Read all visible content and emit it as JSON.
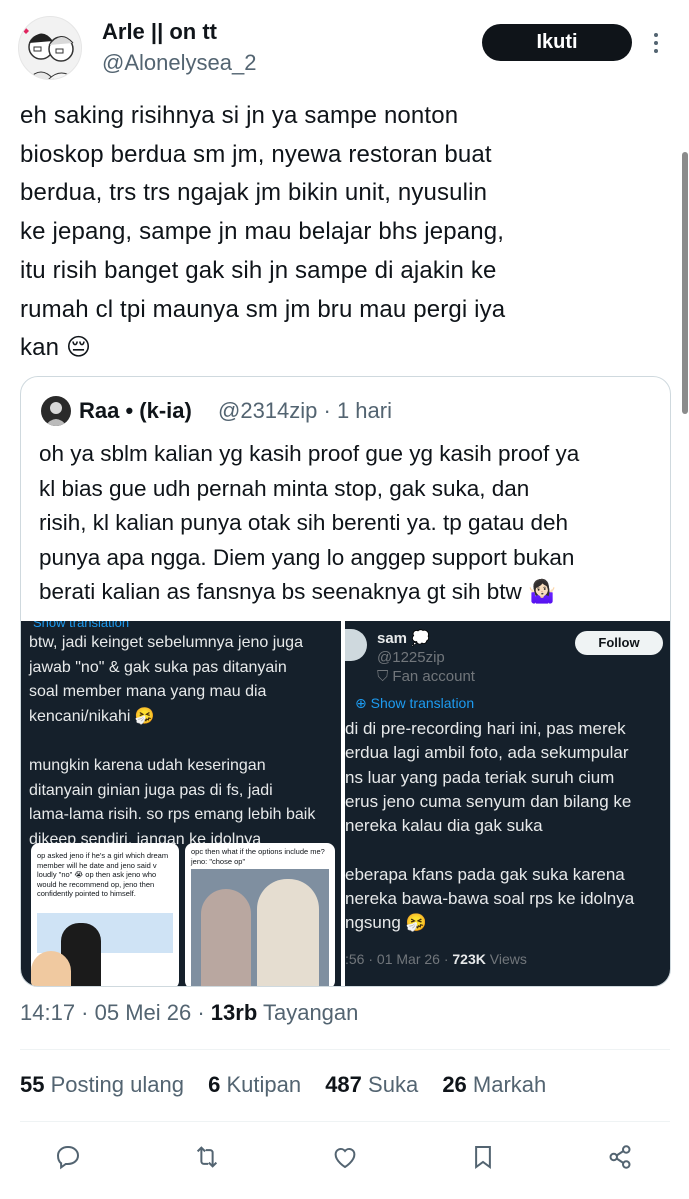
{
  "author": {
    "name": "Arle || on tt",
    "handle": "@Alonelysea_2"
  },
  "follow_label": "Ikuti",
  "tweet_lines": [
    "eh saking risihnya si jn ya sampe nonton",
    "bioskop berdua sm jm, nyewa restoran buat",
    "berdua, trs trs ngajak jm bikin unit, nyusulin",
    "ke jepang, sampe jn mau belajar bhs jepang,",
    "itu risih banget gak sih jn sampe di ajakin ke",
    "rumah cl tpi maunya sm jm bru mau pergi iya",
    "kan 😔"
  ],
  "quote": {
    "name": "Raa • (k-ia)",
    "handle_time": "@2314zip · 1 hari",
    "lines": [
      "oh ya sblm kalian yg kasih proof gue yg kasih proof ya",
      "kl bias gue udh pernah minta stop, gak suka, dan",
      "risih, kl kalian punya otak sih berenti ya. tp gatau deh",
      "punya apa ngga. Diem yang lo anggep support bukan",
      "berati kalian as fansnya bs seenaknya gt sih btw 🤷🏻‍♀️"
    ]
  },
  "media_left": {
    "show_translation": "Show translation",
    "lines": [
      "btw, jadi keinget sebelumnya jeno juga",
      "jawab \"no\" & gak suka pas ditanyain",
      "soal member mana yang mau dia",
      "kencani/nikahi 🤧",
      "",
      "mungkin karena udah keseringan",
      "ditanyain ginian juga pas di fs, jadi",
      "lama-lama risih. so rps emang lebih baik",
      "dikeep sendiri, jangan ke idolnya"
    ],
    "thumb1_text": "op asked jeno if he's a girl which dream member will he date and jeno said v loudly \"no\" 😭 op then ask jeno who would he recommend op, jeno then confidently pointed to himself.",
    "thumb2_text": "opc then what if the options include me? jeno: \"chose op\""
  },
  "media_right": {
    "name": "sam 💭",
    "handle": "@1225zip",
    "fan_account": "Fan account",
    "follow_label": "Follow",
    "show_translation": "Show translation",
    "lines": [
      "di di pre-recording hari ini, pas merek",
      "erdua lagi ambil foto, ada sekumpular",
      "ns luar yang pada teriak suruh cium",
      "erus jeno cuma senyum dan bilang ke",
      "nereka kalau dia gak suka",
      "",
      "eberapa kfans pada gak suka karena",
      "nereka bawa-bawa soal rps ke idolnya",
      "ngsung 🤧"
    ],
    "meta_time": ":56 · 01 Mar 26 · ",
    "meta_views": "723K",
    "meta_views_label": " Views"
  },
  "meta": {
    "time_date": "14:17 · 05 Mei 26 · ",
    "views_count": "13rb",
    "views_label": " Tayangan"
  },
  "stats": {
    "reposts_count": "55",
    "reposts_label": "Posting ulang",
    "quotes_count": "6",
    "quotes_label": "Kutipan",
    "likes_count": "487",
    "likes_label": "Suka",
    "bookmarks_count": "26",
    "bookmarks_label": "Markah"
  }
}
